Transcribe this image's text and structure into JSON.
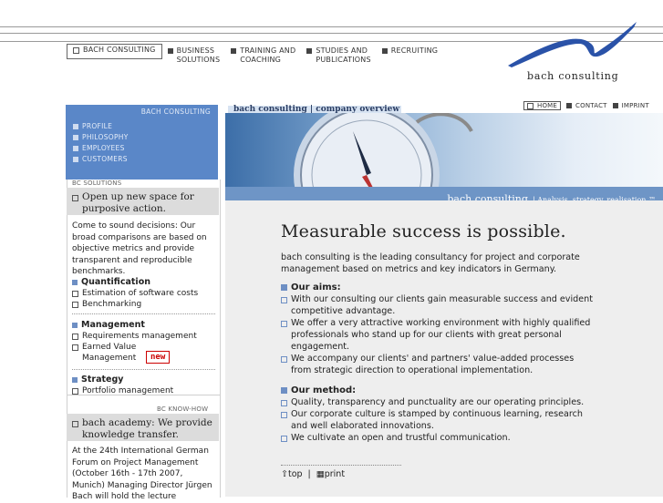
{
  "top_nav": [
    {
      "label": "BACH CONSULTING",
      "active": true
    },
    {
      "label": "BUSINESS\nSOLUTIONS",
      "active": false
    },
    {
      "label": "TRAINING AND\nCOACHING",
      "active": false
    },
    {
      "label": "STUDIES AND\nPUBLICATIONS",
      "active": false
    },
    {
      "label": "RECRUITING",
      "active": false
    }
  ],
  "brand": "bach consulting",
  "sidebar": {
    "title": "BACH CONSULTING",
    "items": [
      "PROFILE",
      "PHILOSOPHY",
      "EMPLOYEES",
      "CUSTOMERS"
    ],
    "solutions": {
      "label": "BC SOLUTIONS",
      "headline": "Open up new space for purposive action.",
      "text": "Come to sound decisions: Our broad comparisons are based on objective metrics and provide transparent and reproducible benchmarks.",
      "sections": [
        {
          "title": "Quantification",
          "items": [
            "Estimation of software costs",
            "Benchmarking"
          ]
        },
        {
          "title": "Management",
          "items": [
            "Requirements management",
            "Earned Value Management"
          ]
        },
        {
          "title": "Strategy",
          "items": [
            "Portfolio management"
          ]
        }
      ],
      "new_badge": "new"
    },
    "knowhow": {
      "label": "BC KNOW-HOW",
      "headline": "bach academy: We provide knowledge transfer.",
      "text": "At the 24th International German Forum on Project Management (October 16th - 17th 2007, Munich) Managing Director Jürgen Bach will hold the lecture"
    }
  },
  "main": {
    "tab_title": "bach consulting | company overview",
    "utility_nav": [
      {
        "label": "HOME",
        "active": true
      },
      {
        "label": "CONTACT",
        "active": false
      },
      {
        "label": "IMPRINT",
        "active": false
      }
    ],
    "banner": {
      "brand": "bach consulting",
      "tagline": "| Analysis, strategy, realisation.™"
    },
    "headline": "Measurable success is possible.",
    "intro": "bach consulting is the leading consultancy for project and corporate management based on metrics and key indicators in Germany.",
    "aims": {
      "title": "Our aims:",
      "items": [
        "With our consulting our clients gain measurable success and evident competitive advantage.",
        "We offer a very attractive working environment with highly qualified professionals who stand up for our clients with great personal engagement.",
        "We accompany our clients' and partners' value-added processes from strategic direction to operational implementation."
      ]
    },
    "method": {
      "title": "Our method:",
      "items": [
        "Quality, transparency and punctuality are our operating principles.",
        "Our corporate culture is stamped by continuous learning, research and well elaborated innovations.",
        "We cultivate an open and trustful communication."
      ]
    },
    "links": {
      "top": "top",
      "separator": "|",
      "print": "print"
    }
  },
  "colors": {
    "accent": "#5a87c8",
    "panel_grey": "#dcdcdc",
    "content_bg": "#eeeeee",
    "new_red": "#cc0000"
  }
}
